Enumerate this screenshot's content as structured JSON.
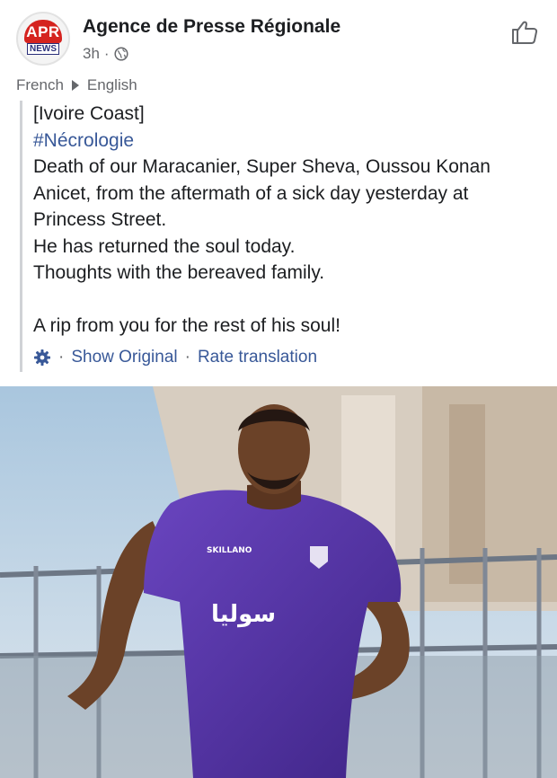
{
  "header": {
    "avatar_top": "APR",
    "avatar_bottom": "NEWS",
    "page_name": "Agence de Presse Régionale",
    "time": "3h",
    "separator": "·",
    "privacy_icon": "globe-icon",
    "like_icon": "thumbs-up-icon"
  },
  "translation_bar": {
    "from": "French",
    "to": "English"
  },
  "post": {
    "lines": [
      "[Ivoire Coast]",
      "#Nécrologie",
      "Death of our Maracanier, Super Sheva, Oussou Konan",
      "Anicet, from the aftermath of a sick day yesterday at",
      "Princess Street.",
      "He has returned the soul today.",
      "Thoughts with the bereaved family.",
      "A rip from you for the rest of his soul!"
    ],
    "hashtag_color": "#385898"
  },
  "actions": {
    "gear_icon": "gear-icon",
    "dot": "·",
    "show_original": "Show Original",
    "rate_translation": "Rate translation"
  },
  "photo": {
    "jersey_sponsor": "SKILLANO",
    "jersey_text": "سوليا",
    "jersey_color": "#5b3aa8"
  }
}
